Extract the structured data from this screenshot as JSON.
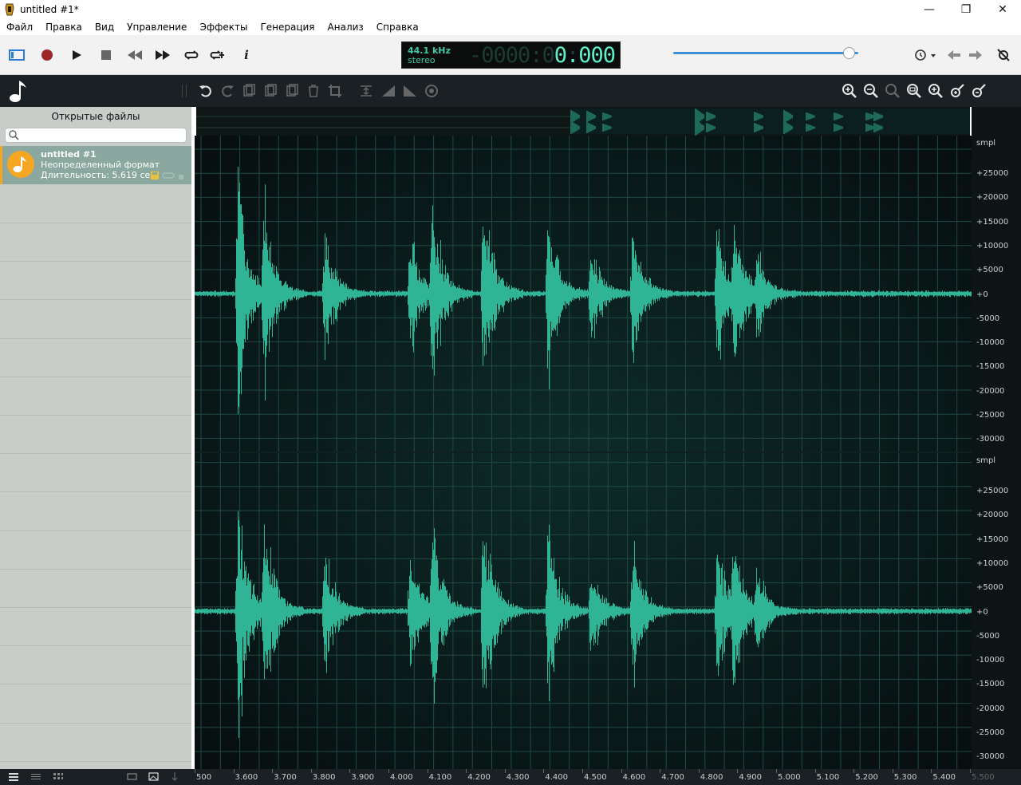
{
  "window": {
    "title": "untitled #1*",
    "minimize": "—",
    "maximize": "❐",
    "close": "✕"
  },
  "menu": [
    "Файл",
    "Правка",
    "Вид",
    "Управление",
    "Эффекты",
    "Генерация",
    "Анализ",
    "Справка"
  ],
  "display": {
    "sample_rate": "44.1 kHz",
    "channels": "stereo",
    "time_ghost": "-0000:00:0",
    "time": "0.000"
  },
  "volume_level": 0.95,
  "sidebar": {
    "header": "Открытые файлы",
    "search_placeholder": "",
    "files": [
      {
        "name": "untitled #1",
        "format": "Неопределенный формат",
        "duration": "Длительность: 5.619 сек"
      }
    ]
  },
  "scale": {
    "unit": "smpl",
    "labels": [
      "+25000",
      "+20000",
      "+15000",
      "+10000",
      "+5000",
      "+0",
      "-5000",
      "-10000",
      "-15000",
      "-20000",
      "-25000",
      "-30000"
    ]
  },
  "timeline": [
    "500",
    "3.600",
    "3.700",
    "3.800",
    "3.900",
    "4.000",
    "4.100",
    "4.200",
    "4.300",
    "4.400",
    "4.500",
    "4.600",
    "4.700",
    "4.800",
    "4.900",
    "5.000",
    "5.100",
    "5.200",
    "5.300",
    "5.400",
    "5.500"
  ],
  "colors": {
    "waveform": "#2fb596",
    "accent": "#f5a623",
    "record": "#b52a2a",
    "volume": "#3e8fd8"
  },
  "icons": {
    "transport": [
      "view-toggle-icon",
      "record-icon",
      "play-icon",
      "stop-icon",
      "rewind-icon",
      "fast-forward-icon",
      "loop-icon",
      "loop-selection-icon",
      "info-icon"
    ],
    "right": [
      "history-icon",
      "back-icon",
      "forward-icon",
      "settings-off-icon"
    ],
    "edit": [
      "undo-icon",
      "redo-icon",
      "cut-icon",
      "copy-icon",
      "paste-icon",
      "delete-icon",
      "crop-icon",
      "normalize-icon",
      "fade-in-icon",
      "fade-out-icon",
      "effect-icon"
    ],
    "zoom": [
      "zoom-in-icon",
      "zoom-out-icon",
      "zoom-fit-icon",
      "zoom-selection-icon",
      "zoom-all-icon",
      "zoom-vertical-in-icon",
      "zoom-vertical-out-icon"
    ]
  }
}
